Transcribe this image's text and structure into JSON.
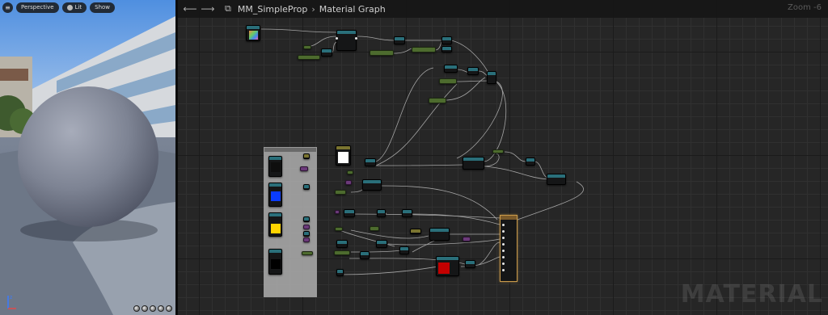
{
  "viewport": {
    "menu_icon": "hamburger-icon",
    "perspective_label": "Perspective",
    "lit_label": "Lit",
    "show_label": "Show",
    "axis_labels": {
      "z": "z",
      "x": "x"
    }
  },
  "graph": {
    "asset_name": "MM_SimpleProp",
    "graph_name": "Material Graph",
    "zoom_label": "Zoom -6",
    "watermark": "MATERIAL",
    "nav_back_icon": "arrow-left-icon",
    "nav_forward_icon": "arrow-right-icon",
    "graph_icon": "material-graph-icon",
    "colors": {
      "grid": "#262626",
      "texture_header": "#2a6f7a",
      "parameter_node": "#4d6b2e",
      "output_node_border": "#c99a4a",
      "swatch_white": "#ffffff",
      "swatch_blue": "#0a3cff",
      "swatch_yellow": "#ffd400",
      "swatch_black": "#000000",
      "swatch_red": "#c40000"
    }
  }
}
